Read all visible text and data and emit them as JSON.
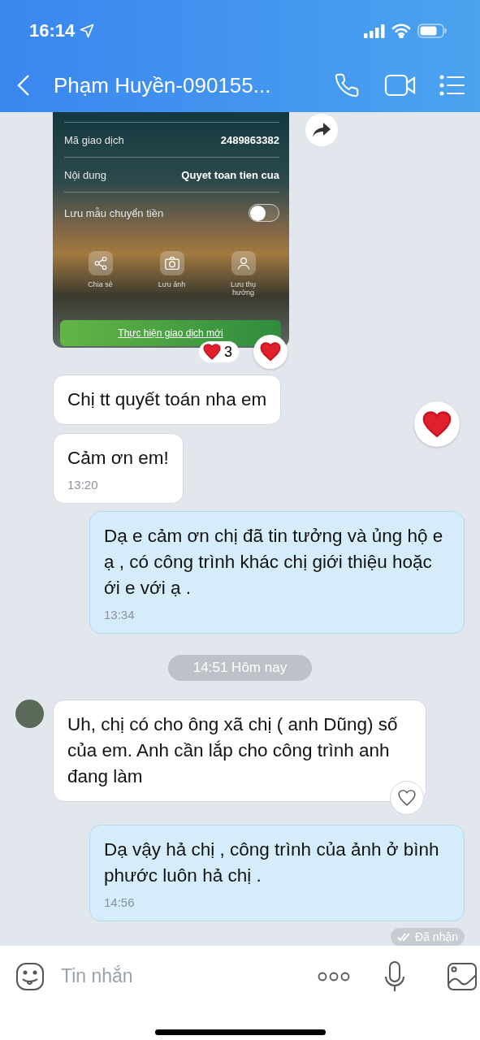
{
  "status_bar": {
    "time": "16:14"
  },
  "header": {
    "title": "Phạm Huyền-090155..."
  },
  "messages": [
    {
      "kind": "receipt_image",
      "rows": [
        {
          "label": "Mã giao dịch",
          "value": "2489863382"
        },
        {
          "label": "Nội dung",
          "value": "Quyet toan tien cua"
        }
      ],
      "toggle": {
        "label": "Lưu mẫu chuyển tiền",
        "on": false
      },
      "actions": [
        {
          "kind": "share",
          "label": "Chia sẻ"
        },
        {
          "kind": "camera",
          "label": "Lưu ảnh"
        },
        {
          "kind": "person",
          "label": "Lưu thụ hưởng"
        }
      ],
      "button": "Thực hiện giao dịch mới",
      "reaction_count": "3",
      "liked": true
    },
    {
      "kind": "received",
      "text": "Chị tt quyết toán nha em",
      "reaction_popup": true
    },
    {
      "kind": "received",
      "text": "Cảm ơn em!",
      "time": "13:20"
    },
    {
      "kind": "sent",
      "text": "Dạ e cảm ơn chị đã tin tưởng và ủng hộ e ạ , có công trình khác chị giới thiệu hoặc ới e với ạ .",
      "time": "13:34"
    },
    {
      "kind": "date_separator",
      "text": "14:51 Hôm nay"
    },
    {
      "kind": "received",
      "text": "Uh, chị có cho ông xã chị ( anh Dũng) số của em. Anh cần lắp cho công trình anh đang làm",
      "avatar": true,
      "liked": false
    },
    {
      "kind": "sent",
      "text": "Dạ vậy hả chị , công trình của ảnh ở bình phước luôn hả chị .",
      "time": "14:56"
    },
    {
      "kind": "status",
      "text": "Đã nhận"
    }
  ],
  "composer": {
    "placeholder": "Tin nhắn"
  }
}
